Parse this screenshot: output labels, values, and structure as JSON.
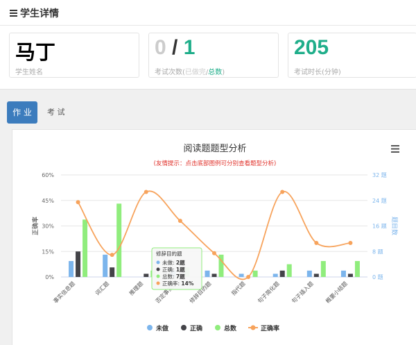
{
  "header": {
    "title": "学生详情"
  },
  "cards": [
    {
      "name": "马丁",
      "label": "学生姓名"
    },
    {
      "attempts": "0",
      "separator": "/",
      "total": "1",
      "label_prefix": "考试次数(",
      "label_done": "已做完",
      "label_slash": "/",
      "label_total": "总数",
      "label_suffix": ")"
    },
    {
      "value": "205",
      "label": "考试时长(分钟)"
    }
  ],
  "tabs": [
    {
      "label": "作 业",
      "active": true
    },
    {
      "label": "考 试",
      "active": false
    }
  ],
  "colors": {
    "blue": "#7cb5ec",
    "black": "#434348",
    "green": "#90ed7d",
    "orange": "#f7a35c",
    "teal": "#1fae8a",
    "brand": "#3c7cbd",
    "hint": "#e0322b",
    "right_axis": "#7cb5ec"
  },
  "chart_data": {
    "type": "bar",
    "title": "阅读题题型分析",
    "subtitle": "(友情提示：点击底部图例可分别查看题型分析)",
    "ylabel": "正确率",
    "ylabel_right": "题目数",
    "y_left_ticks": [
      "0%",
      "15%",
      "30%",
      "45%",
      "60%"
    ],
    "y_right_ticks": [
      "0 题",
      "8 题",
      "16 题",
      "24 题",
      "32 题"
    ],
    "y_left_range": [
      0,
      0.6
    ],
    "y_right_range": [
      0,
      32
    ],
    "categories": [
      "事实信息题",
      "词汇题",
      "推理题",
      "否定事实题",
      "修辞目的题",
      "指代题",
      "句子简化题",
      "句子插入题",
      "概要小结题"
    ],
    "series": [
      {
        "name": "未做",
        "type": "bar",
        "color": "#7cb5ec",
        "values": [
          5,
          7,
          0,
          2,
          2,
          1,
          1,
          2,
          2
        ]
      },
      {
        "name": "正确",
        "type": "bar",
        "color": "#434348",
        "values": [
          8,
          3,
          1,
          1,
          1,
          0,
          2,
          1,
          1
        ]
      },
      {
        "name": "总数",
        "type": "bar",
        "color": "#90ed7d",
        "values": [
          18,
          23,
          2,
          3,
          7,
          2,
          4,
          5,
          5
        ]
      },
      {
        "name": "正确率",
        "type": "line",
        "color": "#f7a35c",
        "values": [
          0.44,
          0.13,
          0.5,
          0.33,
          0.14,
          0,
          0.5,
          0.2,
          0.2
        ]
      }
    ],
    "tooltip": {
      "title": "修辞目的题",
      "rows": [
        {
          "label": "未做: ",
          "value": "2题",
          "color": "#7cb5ec"
        },
        {
          "label": "正确: ",
          "value": "1题",
          "color": "#434348"
        },
        {
          "label": "总数: ",
          "value": "7题",
          "color": "#90ed7d"
        },
        {
          "label": "正确率: ",
          "value": "14%",
          "color": "#f7a35c"
        }
      ]
    }
  }
}
